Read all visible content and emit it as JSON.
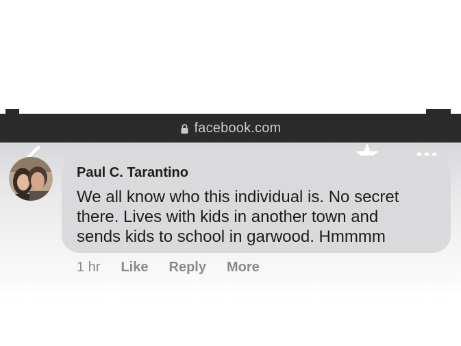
{
  "browser": {
    "url_label": "facebook.com",
    "icons": {
      "lock": "lock-icon",
      "back": "chevron-left-icon",
      "bookmark": "star-icon",
      "menu": "more-dots-icon"
    }
  },
  "comment": {
    "author": "Paul C. Tarantino",
    "lines": [
      "We all know who this individual is. No secret",
      "there. Lives with kids in another town and",
      "sends kids to school in garwood. Hmmmm"
    ],
    "time": "1 hr",
    "actions": {
      "like": "Like",
      "reply": "Reply",
      "more": "More"
    }
  },
  "colors": {
    "address_bar": "#2b2b2b",
    "bubble": "#dadadc",
    "action_text": "#8a8a8e"
  }
}
